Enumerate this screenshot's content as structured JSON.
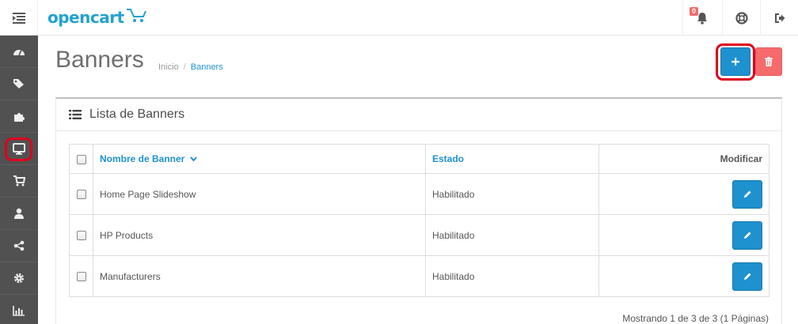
{
  "header": {
    "logo_text": "opencart",
    "notification_count": "0"
  },
  "sidebar": {
    "items": [
      {
        "icon": "dashboard-icon"
      },
      {
        "icon": "tags-icon"
      },
      {
        "icon": "puzzle-icon"
      },
      {
        "icon": "desktop-icon",
        "active": true
      },
      {
        "icon": "cart-icon"
      },
      {
        "icon": "user-icon"
      },
      {
        "icon": "share-icon"
      },
      {
        "icon": "cog-icon"
      },
      {
        "icon": "bar-chart-icon"
      }
    ]
  },
  "page": {
    "title": "Banners",
    "breadcrumb": {
      "home": "Inicio",
      "separator": "/",
      "current": "Banners"
    }
  },
  "panel": {
    "title": "Lista de Banners"
  },
  "table": {
    "columns": {
      "name": "Nombre de Banner",
      "status": "Estado",
      "action": "Modificar"
    },
    "rows": [
      {
        "name": "Home Page Slideshow",
        "status": "Habilitado"
      },
      {
        "name": "HP Products",
        "status": "Habilitado"
      },
      {
        "name": "Manufacturers",
        "status": "Habilitado"
      }
    ]
  },
  "pagination": {
    "summary": "Mostrando 1 de 3 de 3 (1 Páginas)"
  },
  "colors": {
    "primary": "#1e91cf",
    "danger": "#f56b6b",
    "sidebar": "#515151",
    "highlight": "#e0001a"
  }
}
